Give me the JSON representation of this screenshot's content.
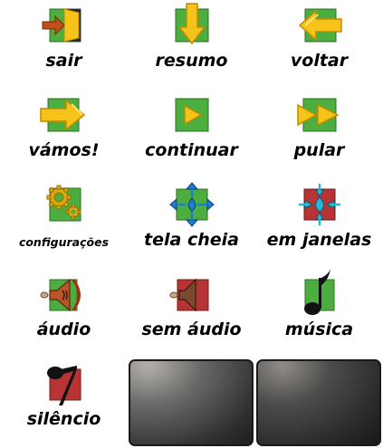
{
  "buttons": [
    {
      "label": "sair",
      "icon": "exit-icon"
    },
    {
      "label": "resumo",
      "icon": "arrow-down-icon"
    },
    {
      "label": "voltar",
      "icon": "arrow-back-icon"
    },
    {
      "label": "vámos!",
      "icon": "arrow-forward-icon"
    },
    {
      "label": "continuar",
      "icon": "play-icon"
    },
    {
      "label": "pular",
      "icon": "fast-forward-icon"
    },
    {
      "label": "configurações",
      "icon": "gears-icon"
    },
    {
      "label": "tela cheia",
      "icon": "fullscreen-icon"
    },
    {
      "label": "em janelas",
      "icon": "windowed-icon"
    },
    {
      "label": "áudio",
      "icon": "speaker-on-icon"
    },
    {
      "label": "sem áudio",
      "icon": "speaker-off-icon"
    },
    {
      "label": "música",
      "icon": "music-note-icon"
    },
    {
      "label": "silêncio",
      "icon": "music-off-icon"
    }
  ],
  "colors": {
    "green": "#4cae3e",
    "red": "#b83434",
    "arrow_yellow": "#f6c31a",
    "blue": "#1f7fd0"
  }
}
